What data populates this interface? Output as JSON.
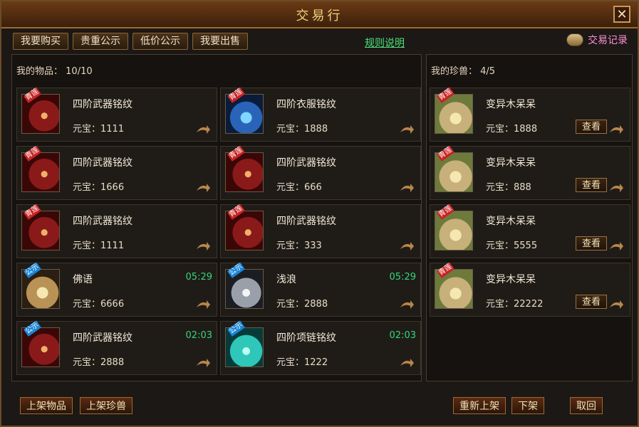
{
  "window": {
    "title": "交易行",
    "close_label": "✕"
  },
  "tabs": [
    "我要购买",
    "贵重公示",
    "低价公示",
    "我要出售"
  ],
  "rules_link": "规则说明",
  "records_label": "交易记录",
  "left_panel": {
    "label": "我的物品：",
    "count": "10/10",
    "items": [
      {
        "name": "四阶武器铭纹",
        "price_label": "元宝：",
        "price": "1111",
        "timer": "",
        "badge": "青莲",
        "icon": "weapon-inscription-icon"
      },
      {
        "name": "四阶衣服铭纹",
        "price_label": "元宝：",
        "price": "1888",
        "timer": "",
        "badge": "青莲",
        "icon": "clothes-inscription-icon"
      },
      {
        "name": "四阶武器铭纹",
        "price_label": "元宝：",
        "price": "1666",
        "timer": "",
        "badge": "青莲",
        "icon": "weapon-inscription-icon"
      },
      {
        "name": "四阶武器铭纹",
        "price_label": "元宝：",
        "price": "666",
        "timer": "",
        "badge": "青莲",
        "icon": "weapon-inscription-icon"
      },
      {
        "name": "四阶武器铭纹",
        "price_label": "元宝：",
        "price": "1111",
        "timer": "",
        "badge": "青莲",
        "icon": "weapon-inscription-icon"
      },
      {
        "name": "四阶武器铭纹",
        "price_label": "元宝：",
        "price": "333",
        "timer": "",
        "badge": "青莲",
        "icon": "weapon-inscription-icon"
      },
      {
        "name": "佛语",
        "price_label": "元宝：",
        "price": "6666",
        "timer": "05:29",
        "badge": "公示",
        "icon": "sutra-item-icon"
      },
      {
        "name": "浅浪",
        "price_label": "元宝：",
        "price": "2888",
        "timer": "05:29",
        "badge": "公示",
        "icon": "bead-string-icon"
      },
      {
        "name": "四阶武器铭纹",
        "price_label": "元宝：",
        "price": "2888",
        "timer": "02:03",
        "badge": "公示",
        "icon": "weapon-inscription-icon"
      },
      {
        "name": "四阶项链铭纹",
        "price_label": "元宝：",
        "price": "1222",
        "timer": "02:03",
        "badge": "公示",
        "icon": "necklace-inscription-icon"
      }
    ]
  },
  "right_panel": {
    "label": "我的珍兽：",
    "count": "4/5",
    "items": [
      {
        "name": "变异木呆呆",
        "price_label": "元宝：",
        "price": "1888",
        "badge": "青莲",
        "view_label": "查看"
      },
      {
        "name": "变异木呆呆",
        "price_label": "元宝：",
        "price": "888",
        "badge": "青莲",
        "view_label": "查看"
      },
      {
        "name": "变异木呆呆",
        "price_label": "元宝：",
        "price": "5555",
        "badge": "青莲",
        "view_label": "查看"
      },
      {
        "name": "变异木呆呆",
        "price_label": "元宝：",
        "price": "22222",
        "badge": "青莲",
        "view_label": "查看"
      }
    ]
  },
  "bottom_buttons": {
    "list_item": "上架物品",
    "list_pet": "上架珍兽",
    "relist": "重新上架",
    "delist": "下架",
    "cancel": "取回"
  },
  "colors": {
    "accent_gold": "#f2d07a",
    "timer_green": "#36d57a",
    "rules_green": "#4de07a",
    "records_pink": "#ff8fd1"
  }
}
